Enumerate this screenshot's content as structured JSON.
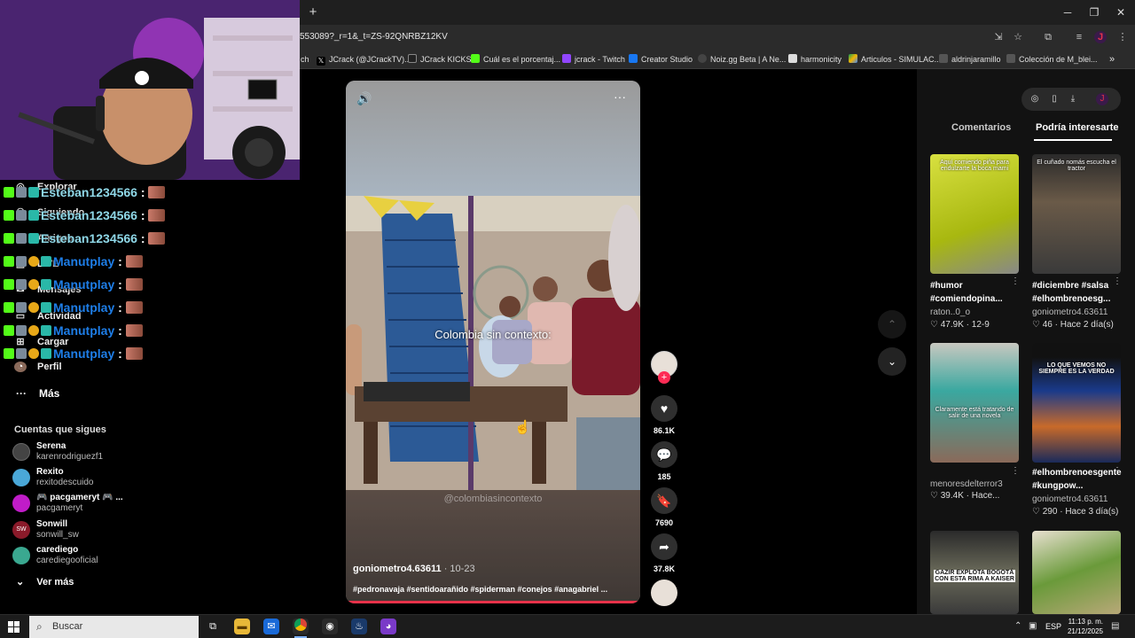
{
  "browser": {
    "url": "553089?_r=1&_t=ZS-92QNRBZ12KV",
    "new_tab_symbol": "+",
    "bookmarks": [
      {
        "label": "ch",
        "icon": "page-icon",
        "color": "#888888"
      },
      {
        "label": "JCrack (@JCrackTV)...",
        "icon": "x-logo-icon",
        "color": "#000000"
      },
      {
        "label": "JCrack KICKS",
        "icon": "jcrack-logo-icon",
        "color": "#222222"
      },
      {
        "label": "Cuál es el porcentaj...",
        "icon": "kick-logo-icon",
        "color": "#53fc18"
      },
      {
        "label": "jcrack - Twitch",
        "icon": "twitch-logo-icon",
        "color": "#9146ff"
      },
      {
        "label": "Creator Studio",
        "icon": "facebook-logo-icon",
        "color": "#1877f2"
      },
      {
        "label": "Noiz.gg Beta | A Ne...",
        "icon": "noiz-logo-icon",
        "color": "#444444"
      },
      {
        "label": "harmonicity",
        "icon": "harmonicity-logo-icon",
        "color": "#dddddd"
      },
      {
        "label": "Articulos - SIMULAC...",
        "icon": "drive-logo-icon",
        "color": "#f4b400"
      },
      {
        "label": "aldrinjaramillo",
        "icon": "page-icon",
        "color": "#555555"
      },
      {
        "label": "Colección de M_blei...",
        "icon": "page-icon",
        "color": "#555555"
      }
    ],
    "more_bookmarks": "»"
  },
  "sidebar": {
    "nav": [
      {
        "label": "Explorar",
        "icon": "compass-icon"
      },
      {
        "label": "Siguiendo",
        "icon": "people-icon"
      },
      {
        "label": "Amigos",
        "icon": "friends-icon"
      },
      {
        "label": "LIVE",
        "icon": "live-icon"
      },
      {
        "label": "Mensajes",
        "icon": "message-icon"
      },
      {
        "label": "Actividad",
        "icon": "activity-icon"
      },
      {
        "label": "Cargar",
        "icon": "upload-icon"
      },
      {
        "label": "Perfil",
        "icon": "profile-icon"
      }
    ],
    "more_label": "Más",
    "following_title": "Cuentas que sigues",
    "accounts": [
      {
        "name": "Serena",
        "user": "karenrodriguezf1",
        "color": "#444444"
      },
      {
        "name": "Rexito",
        "user": "rexitodescuido",
        "color": "#4aa8d8"
      },
      {
        "name": "🎮 pacgameryt 🎮 ...",
        "user": "pacgameryt",
        "color": "#c01cc8"
      },
      {
        "name": "Sonwill",
        "user": "sonwill_sw",
        "color": "#8a1a2a"
      },
      {
        "name": "carediego",
        "user": "carediegooficial",
        "color": "#3aa890"
      }
    ],
    "see_more": "Ver más"
  },
  "chat": [
    {
      "user": "Esteban1234566",
      "sep": ":",
      "color": "#8fd8e8"
    },
    {
      "user": "Esteban1234566",
      "sep": ":",
      "color": "#8fd8e8"
    },
    {
      "user": "Esteban1234566",
      "sep": ":",
      "color": "#8fd8e8"
    },
    {
      "user": "Manutplay",
      "sep": ":",
      "color": "#1e7ee8"
    },
    {
      "user": "Manutplay",
      "sep": ":",
      "color": "#1e7ee8"
    },
    {
      "user": "Manutplay",
      "sep": ":",
      "color": "#1e7ee8"
    },
    {
      "user": "Manutplay",
      "sep": ":",
      "color": "#1e7ee8"
    },
    {
      "user": "Manutplay",
      "sep": ":",
      "color": "#1e7ee8"
    }
  ],
  "video": {
    "caption": "Colombia sin contexto:",
    "watermark": "@colombiasincontexto",
    "author": "goniometro4.63611",
    "date": " · 10-23",
    "tags": "#pedronavaja #sentidoarañido #spiderman #conejos #anagabriel ...",
    "progress": 1.0
  },
  "actions": {
    "likes": "86.1K",
    "comments": "185",
    "saves": "7690",
    "shares": "37.8K"
  },
  "right_panel": {
    "tabs": [
      "Comentarios",
      "Podría interesarte"
    ],
    "active_tab": "Podría interesarte",
    "items": [
      {
        "overlay": "Aquí comiendo piña para endulzarte la boca mami",
        "title": "#humor #comiendopina...",
        "author": "raton..0_o",
        "likes": "47.9K",
        "date": "12-9"
      },
      {
        "overlay": "El cuñado nomás escucha el tractor",
        "title": "#diciembre #salsa #elhombrenoesg...",
        "author": "goniometro4.63611",
        "likes": "46",
        "date": "Hace 2 día(s)"
      },
      {
        "overlay": "Claramente está tratando de salir de una novela",
        "title": "",
        "author": "menoresdelterror3",
        "likes": "39.4K",
        "date": "Hace..."
      },
      {
        "overlay": "LO QUE VEMOS NO SIEMPRE ES LA VERDAD",
        "title": "#elhombrenoesgente #kungpow...",
        "author": "goniometro4.63611",
        "likes": "290",
        "date": "Hace 3 día(s)"
      },
      {
        "overlay": "GAZIR EXPLOTA BOGOTÁ CON ESTA RIMA A KAISER",
        "title": "",
        "author": "",
        "likes": "",
        "date": ""
      },
      {
        "overlay": "",
        "title": "",
        "author": "",
        "likes": "",
        "date": ""
      }
    ]
  },
  "taskbar": {
    "search_placeholder": "Buscar",
    "lang": "ESP",
    "time": "11:13 p. m.",
    "date": "21/12/2025"
  }
}
